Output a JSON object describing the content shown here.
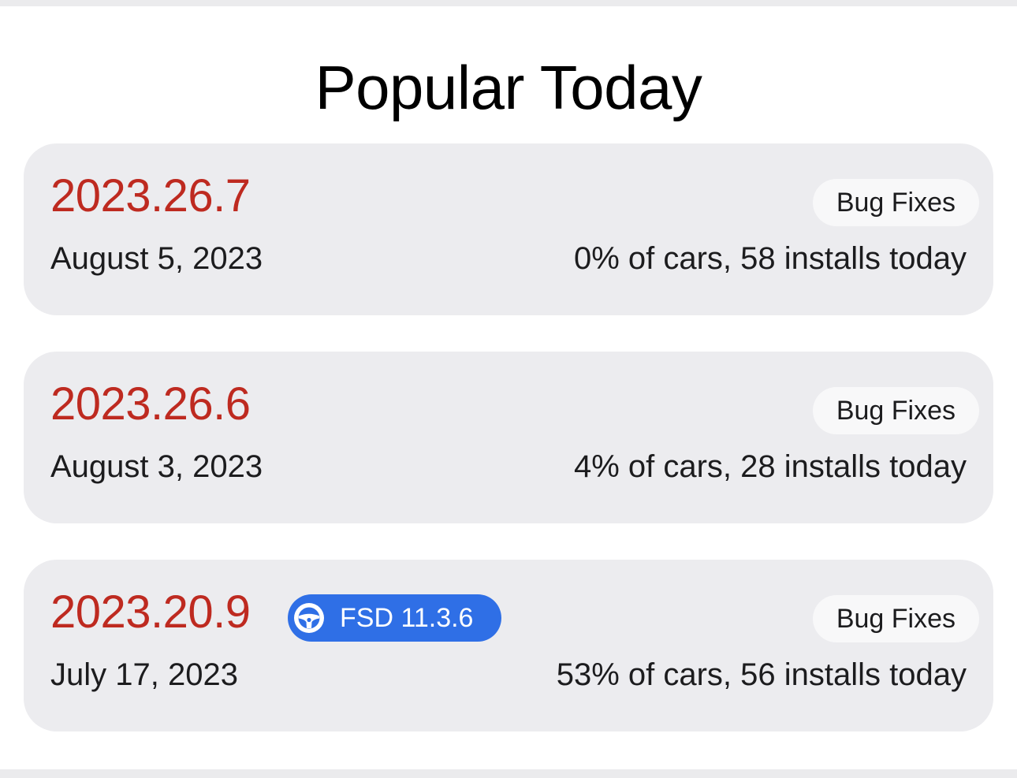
{
  "header": {
    "title": "Popular Today"
  },
  "releases": [
    {
      "version": "2023.26.7",
      "date": "August 5, 2023",
      "badge": "Bug Fixes",
      "stats": "0% of cars, 58 installs today"
    },
    {
      "version": "2023.26.6",
      "date": "August 3, 2023",
      "badge": "Bug Fixes",
      "stats": "4% of cars, 28 installs today"
    },
    {
      "version": "2023.20.9",
      "date": "July 17, 2023",
      "badge": "Bug Fixes",
      "stats": "53% of cars, 56 installs today",
      "fsd_tag": "FSD 11.3.6",
      "fsd_icon": "steering-wheel-icon"
    }
  ],
  "colors": {
    "version_text": "#be2a20",
    "fsd_tag_background": "#2f6fe6",
    "card_background": "#ececef",
    "badge_background": "#f8f8f9"
  }
}
